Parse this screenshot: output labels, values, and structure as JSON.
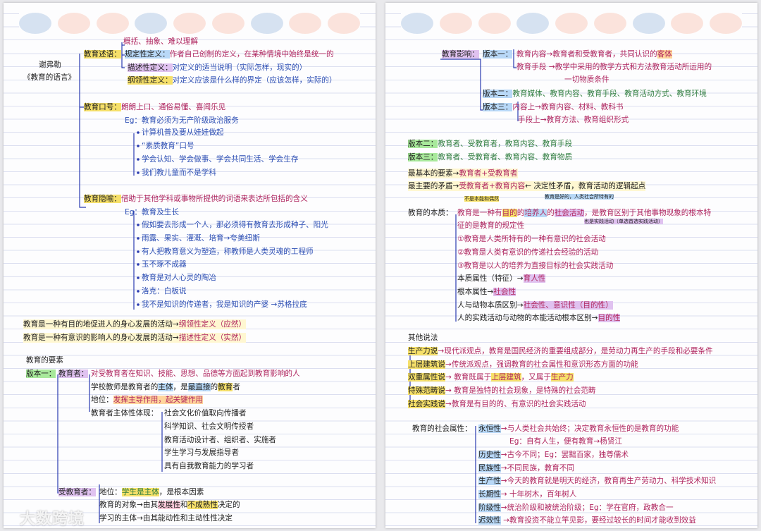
{
  "colors": {
    "accent_red": "#b0265f",
    "accent_blue": "#2d4fb4",
    "accent_green": "#2f7d3f",
    "dots": [
      "#d6e2f1",
      "#fbe3dc",
      "#fbe3dc",
      "#d6e2f1",
      "#fbe3dc",
      "#fbe3dc",
      "#d6e2f1",
      "#fbe3dc",
      "#fbe3dc"
    ]
  },
  "left": {
    "author": "谢弗勒",
    "book": "《教育的语言》",
    "top_note": "概括、抽象、难以理解",
    "stated": {
      "head": "教育述语：",
      "l1a": "规定性定义：",
      "l1b": "作者自己创制的定义，在某种情境中始终是统一的",
      "l2a": "描述性定义：",
      "l2b": "对定义的适当说明（实际怎样，现实的）",
      "l3a": "纲领性定义：",
      "l3b": "对定义应该是什么样的界定（应该怎样，实际的）"
    },
    "slogan": {
      "head": "教育口号：",
      "desc": "朗朗上口、通俗易懂、喜闻乐见",
      "eg": "Eg：教育必须为无产阶级政治服务",
      "items": [
        "计算机普及要从娃娃做起",
        "“素质教育”口号",
        "学会认知、学会做事、学会共同生活、学会生存",
        "我们教儿童而不是学科"
      ]
    },
    "metaphor": {
      "head": "教育隐喻：",
      "desc": "借助于其他学科或事物所提供的词语来表达所包括的含义",
      "eg": "Eg：教育及生长",
      "items": [
        "假如要去形成一个人，那必须得有教育去形成种子、阳光",
        "雨露、果实、灌溉、培育→夸美纽斯",
        "有人把教育意义为塑造，称教师是人类灵魂的工程师",
        "玉不琢不成器",
        "教育是对人心灵的陶冶",
        "洛克：白板说",
        "我不是知识的传递者，我是知识的产婆 →苏格拉底"
      ]
    },
    "defs": [
      {
        "a": "教育是一种有目的地促进人的身心发展的活动→",
        "b": "纲领性定义（应然）"
      },
      {
        "a": "教育是一种有意识的影响人的身心发展的活动→",
        "b": "描述性定义（实然）"
      }
    ],
    "elements": {
      "title": "教育的要素",
      "v1": "版本一：",
      "educator": "教育者：",
      "e1": "对受教育者在知识、技能、思想、品德等方面起到教育影响的人",
      "e2a": "学校教师是教育者的",
      "e2b": "主体",
      "e2c": "，是",
      "e2d": "最直接",
      "e2e": "的",
      "e2f": "教育",
      "e2g": "者",
      "e3a": "地位：",
      "e3b": "发挥主导作用，起关键作用",
      "e4": "教育者主体性体现：",
      "subj": [
        "社会文化价值取向传播者",
        "科学知识、社会文明传授者",
        "教育活动设计者、组织者、实施者",
        "学生学习与发展指导者",
        "具有自我教育能力的学习者"
      ],
      "learner": "受教育者：",
      "s1a": "地位：",
      "s1b": "学生是主体",
      "s1c": "，是根本因素",
      "s2a": "教育的对象→由其",
      "s2b": "发展性",
      "s2c": "和",
      "s2d": "不成熟性",
      "s2e": "决定的",
      "s3a": "学习的主体→由其能动性和主动性性决定"
    }
  },
  "right": {
    "influence": {
      "head": "教育影响：",
      "v1": "版本一：",
      "c1": "教育内容→教育者和受教育者，共同认识的",
      "c1b": "客体",
      "c2": "教育手段 →教学中采用的教学方式和方法教育活动所运用的",
      "c3": "一切物质条件",
      "v2": "版本二：",
      "v2t": "教育媒体、教育内容、教育手段、教育活动方式、教育环境",
      "v3": "版本三：",
      "v3a": "内容上→教育内容、材料、教科书",
      "v3b": "手段上→教育方法、教育组织形式"
    },
    "v2line": {
      "a": "版本二：",
      "b": "教育者、受教育者，教育内容、教育手段"
    },
    "v3line": {
      "a": "版本三：",
      "b": "教育者、受教育者、教育内容、教育物质"
    },
    "basic": {
      "a": "最基本的要素→",
      "b": "教育者+受教育者"
    },
    "main": {
      "a": "最主要的矛盾→",
      "b": "受教育者+教育内容",
      "c": "← 决定性矛盾，教育活动的逻辑起点"
    },
    "essence": {
      "note1": "不是本能和偶然",
      "note2": "教育是好的，人类社会所特有的",
      "note3": "也是实践活动（单选首选实践活动）",
      "head": "教育的本质：",
      "l1a": "教育是一种有",
      "l1b": "目的",
      "l1c": "的",
      "l1d": "培养人",
      "l1e": "的",
      "l1f": "社会活动",
      "l1g": "，是教育区别于其他事物现象的根本特",
      "l2": "征的是教育的规定性",
      "items": [
        "①教育是人类所特有的一种有意识的社会活动",
        "②教育是人类有意识的传递社会经验的活动",
        "③教育是以人的培养为直接目标的社会实践活动"
      ],
      "p1a": "本质属性（特征）→",
      "p1b": "育人性",
      "p2a": "根本属性→",
      "p2b": "社会性",
      "p3a": "人与动物本质区别→",
      "p3b": "社会性、意识性（目的性）",
      "p4a": "人的实践活动与动物的本能活动根本区别→",
      "p4b": "目的性"
    },
    "others": {
      "title": "其他说法",
      "rows": [
        {
          "a": "生产力说",
          "b": "→现代派观点，教育是国民经济的重要组成部分，是劳动力再生产的手段和必要条件"
        },
        {
          "a": "上层建筑说",
          "b": "→传统派观点，强调教育的社会属性和意识形态方面的功能"
        },
        {
          "a": "双重属性说",
          "b": "→ 教育既属于",
          "c": "上层建筑",
          "d": "，又属于",
          "e": "生产力"
        },
        {
          "a": "特殊范畴说",
          "b": "→ 教育是独特的社会现象，是特殊的社会范畴"
        },
        {
          "a": "社会实践说",
          "b": "→教育是有目的的、有意识的社会实践活动"
        }
      ]
    },
    "social": {
      "head": "教育的社会属性：",
      "rows": [
        {
          "a": "永恒性",
          "b": "→与人类社会共始终；决定教育永恒性的是教育的功能"
        },
        {
          "a": "",
          "b": "Eg：自有人生，便有教育→杨贤江"
        },
        {
          "a": "历史性",
          "b": "→古今不同；Eg：罢黜百家，独尊儒术"
        },
        {
          "a": "民族性",
          "b": "→不同民族，教育不同"
        },
        {
          "a": "生产性",
          "b": "→今天的教育就是明天的经济，教育再生产劳动力、科学技术知识"
        },
        {
          "a": "长期性",
          "b": "→ 十年树木，百年树人"
        },
        {
          "a": "阶级性",
          "b": "→统治阶级和被统治阶级；Eg：学在官府，政教合一"
        },
        {
          "a": "迟效性",
          "b": " →教育投资不能立竿见影，要经过较长的时间才能收到效益"
        }
      ]
    }
  },
  "watermark": "大数跨境"
}
